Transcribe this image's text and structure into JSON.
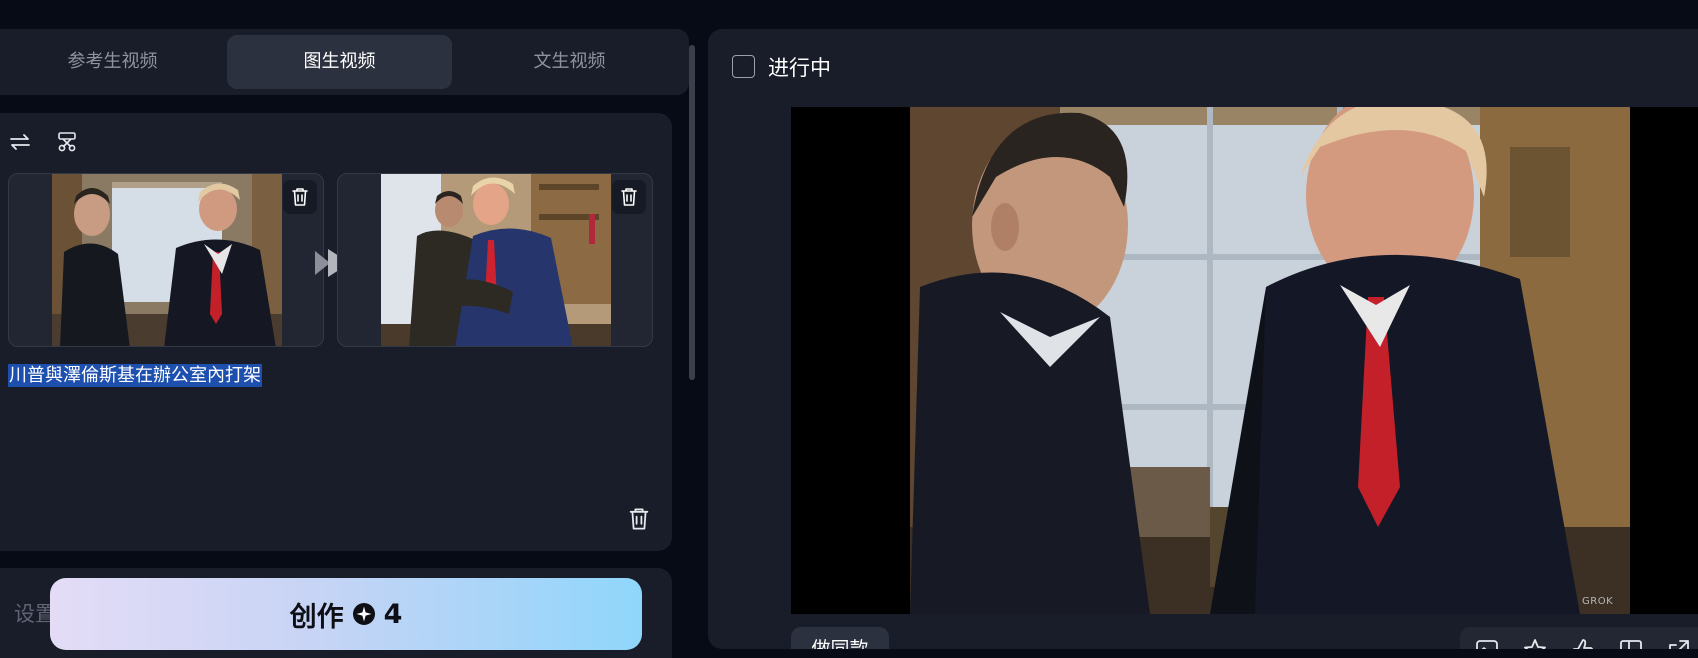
{
  "tabs": [
    {
      "label": "参考生视频"
    },
    {
      "label": "图生视频"
    },
    {
      "label": "文生视频"
    }
  ],
  "active_tab": "图生视频",
  "editor": {
    "prompt": "川普與澤倫斯基在辦公室內打架",
    "start_frame_alt": "first frame",
    "end_frame_alt": "last frame"
  },
  "settings": {
    "label": "设置"
  },
  "create": {
    "label": "创作",
    "credits": "4"
  },
  "result": {
    "status": "进行中",
    "watermark": "GROK",
    "same_style_label": "做同款"
  },
  "icons": {
    "swap": "swap-icon",
    "cut": "scissors-icon",
    "trash": "trash-icon",
    "arrow": "play-arrow-icon",
    "credit": "credit-star-icon",
    "actions": [
      "image-icon",
      "star-icon",
      "thumbs-up-icon",
      "layout-icon",
      "share-icon"
    ]
  },
  "colors": {
    "background": "#060b16",
    "panel": "#191d29",
    "active_tab": "#2c3140",
    "prompt_highlight": "#1d4fae",
    "create_gradient_start": "#e4dcf6",
    "create_gradient_end": "#8fd6fb"
  }
}
